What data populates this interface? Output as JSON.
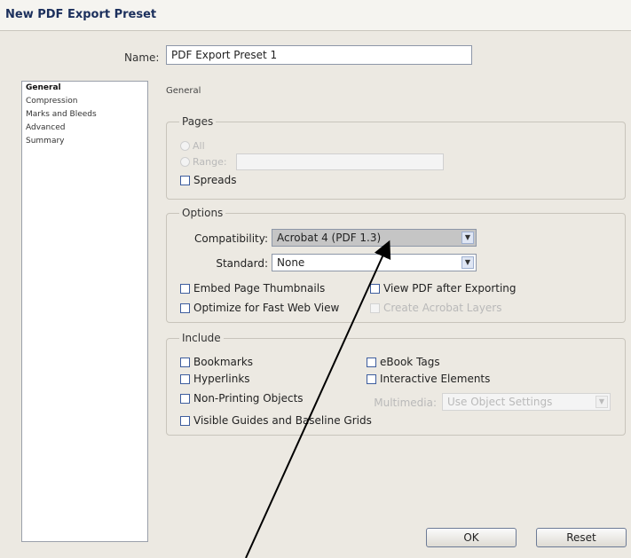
{
  "window": {
    "title": "New PDF Export Preset"
  },
  "name": {
    "label": "Name:",
    "value": "PDF Export Preset 1"
  },
  "sidebar": {
    "items": [
      {
        "label": "General",
        "selected": true
      },
      {
        "label": "Compression"
      },
      {
        "label": "Marks and Bleeds"
      },
      {
        "label": "Advanced"
      },
      {
        "label": "Summary"
      }
    ]
  },
  "section_title": "General",
  "pages": {
    "title": "Pages",
    "all_label": "All",
    "range_label": "Range:",
    "spreads_label": "Spreads"
  },
  "options": {
    "title": "Options",
    "compat_label": "Compatibility:",
    "compat_value": "Acrobat 4 (PDF 1.3)",
    "standard_label": "Standard:",
    "standard_value": "None",
    "embed_label": "Embed Page Thumbnails",
    "optimize_label": "Optimize for Fast Web View",
    "view_label": "View PDF after Exporting",
    "layers_label": "Create Acrobat Layers"
  },
  "include": {
    "title": "Include",
    "bookmarks_label": "Bookmarks",
    "hyperlinks_label": "Hyperlinks",
    "nonprinting_label": "Non-Printing Objects",
    "guides_label": "Visible Guides and Baseline Grids",
    "ebook_label": "eBook Tags",
    "interactive_label": "Interactive Elements",
    "multimedia_label": "Multimedia:",
    "multimedia_value": "Use Object Settings"
  },
  "buttons": {
    "ok": "OK",
    "reset": "Reset"
  }
}
